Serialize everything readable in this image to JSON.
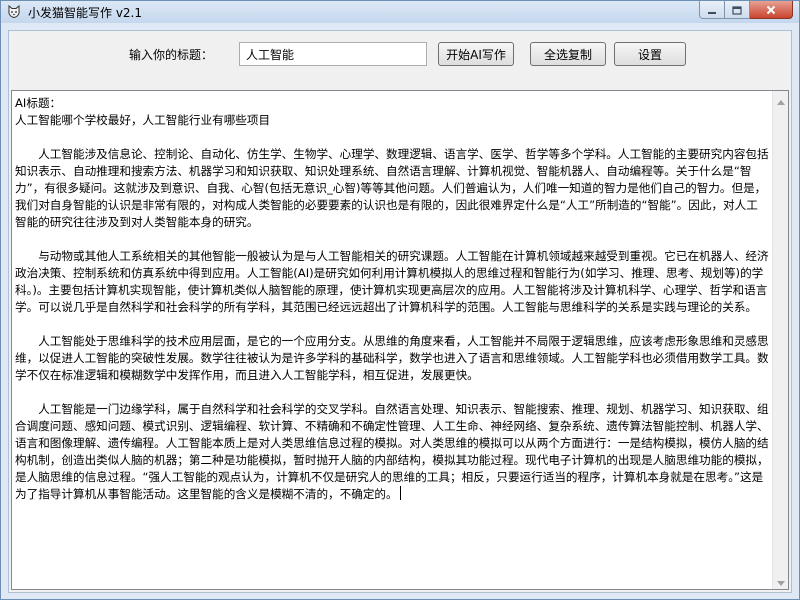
{
  "window": {
    "title": "小发猫智能写作 v2.1"
  },
  "toolbar": {
    "title_label": "输入你的标题：",
    "title_value": "人工智能",
    "write_label": "开始AI写作",
    "copy_label": "全选复制",
    "settings_label": "设置"
  },
  "content": {
    "heading": "AI标题：",
    "title_line": "人工智能哪个学校最好，人工智能行业有哪些项目",
    "paragraphs": [
      "人工智能涉及信息论、控制论、自动化、仿生学、生物学、心理学、数理逻辑、语言学、医学、哲学等多个学科。人工智能的主要研究内容包括知识表示、自动推理和搜索方法、机器学习和知识获取、知识处理系统、自然语言理解、计算机视觉、智能机器人、自动编程等。关于什么是“智力”，有很多疑问。这就涉及到意识、自我、心智(包括无意识_心智)等等其他问题。人们普遍认为，人们唯一知道的智力是他们自己的智力。但是，我们对自身智能的认识是非常有限的，对构成人类智能的必要要素的认识也是有限的，因此很难界定什么是“人工”所制造的“智能”。因此，对人工智能的研究往往涉及到对人类智能本身的研究。",
      "与动物或其他人工系统相关的其他智能一般被认为是与人工智能相关的研究课题。人工智能在计算机领域越来越受到重视。它已在机器人、经济政治决策、控制系统和仿真系统中得到应用。人工智能(AI)是研究如何利用计算机模拟人的思维过程和智能行为(如学习、推理、思考、规划等)的学科。)。主要包括计算机实现智能，使计算机类似人脑智能的原理，使计算机实现更高层次的应用。人工智能将涉及计算机科学、心理学、哲学和语言学。可以说几乎是自然科学和社会科学的所有学科，其范围已经远远超出了计算机科学的范围。人工智能与思维科学的关系是实践与理论的关系。",
      "人工智能处于思维科学的技术应用层面，是它的一个应用分支。从思维的角度来看，人工智能并不局限于逻辑思维，应该考虑形象思维和灵感思维，以促进人工智能的突破性发展。数学往往被认为是许多学科的基础科学，数学也进入了语言和思维领域。人工智能学科也必须借用数学工具。数学不仅在标准逻辑和模糊数学中发挥作用，而且进入人工智能学科，相互促进，发展更快。",
      "人工智能是一门边缘学科，属于自然科学和社会科学的交叉学科。自然语言处理、知识表示、智能搜索、推理、规划、机器学习、知识获取、组合调度问题、感知问题、模式识别、逻辑编程、软计算、不精确和不确定性管理、人工生命、神经网络、复杂系统、遗传算法智能控制、机器人学、语言和图像理解、遗传编程。人工智能本质上是对人类思维信息过程的模拟。对人类思维的模拟可以从两个方面进行：一是结构模拟，模仿人脑的结构机制，创造出类似人脑的机器；第二种是功能模拟，暂时抛开人脑的内部结构，模拟其功能过程。现代电子计算机的出现是人脑思维功能的模拟，是人脑思维的信息过程。“强人工智能的观点认为，计算机不仅是研究人的思维的工具；相反，只要运行适当的程序，计算机本身就是在思考。”这是为了指导计算机从事智能活动。这里智能的含义是模糊不清的，不确定的。"
    ]
  }
}
